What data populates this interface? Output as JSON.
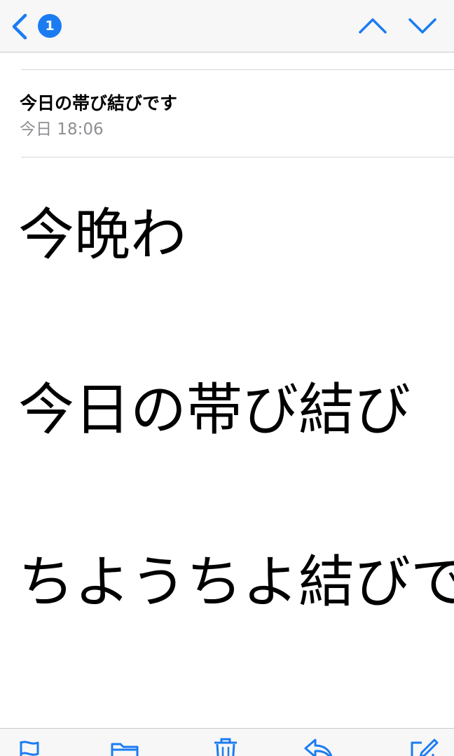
{
  "nav": {
    "back_badge": "1",
    "accent": "#1b7cf2",
    "icons": [
      "chevron-left-icon",
      "chevron-up-icon",
      "chevron-down-icon"
    ]
  },
  "message": {
    "subject": "今日の帯び結びです",
    "date": "今日 18:06"
  },
  "body": {
    "lines": [
      "今晩わ",
      "今日の帯び結び",
      "ちようちよ結びで"
    ]
  },
  "toolbar": {
    "icons": [
      "flag-icon",
      "folder-icon",
      "trash-icon",
      "reply-icon",
      "compose-icon"
    ]
  }
}
